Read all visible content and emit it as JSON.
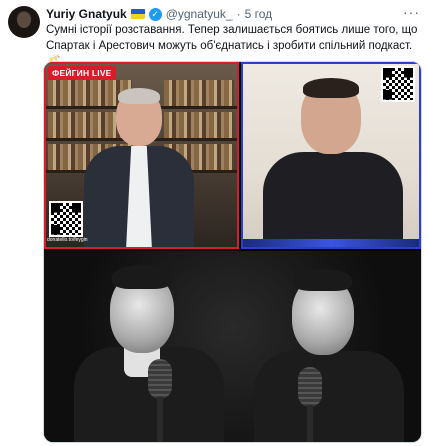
{
  "tweet": {
    "author_name": "Yuriy Gnatyuk",
    "handle": "@ygnatyuk_",
    "separator": "·",
    "time": "5 год",
    "more_label": "···",
    "verified_glyph": "✓",
    "text": "Сумні історії розставання. Тепер залишається боятись лише того, що Спартак і Арестович можуть об'єднатись і зробити спільний подкаст. 🥂"
  },
  "media": {
    "live_badge": "ФЕЙГИН LIVE",
    "qr_caption": "donatello.to/feygin"
  },
  "icons": [
    "ukraine-flag-icon",
    "verified-badge-icon",
    "more-icon"
  ],
  "colors": {
    "accent_blue": "#1d9bf0",
    "live_red": "#d81d2a",
    "frame_blue": "#2b3fc9"
  }
}
